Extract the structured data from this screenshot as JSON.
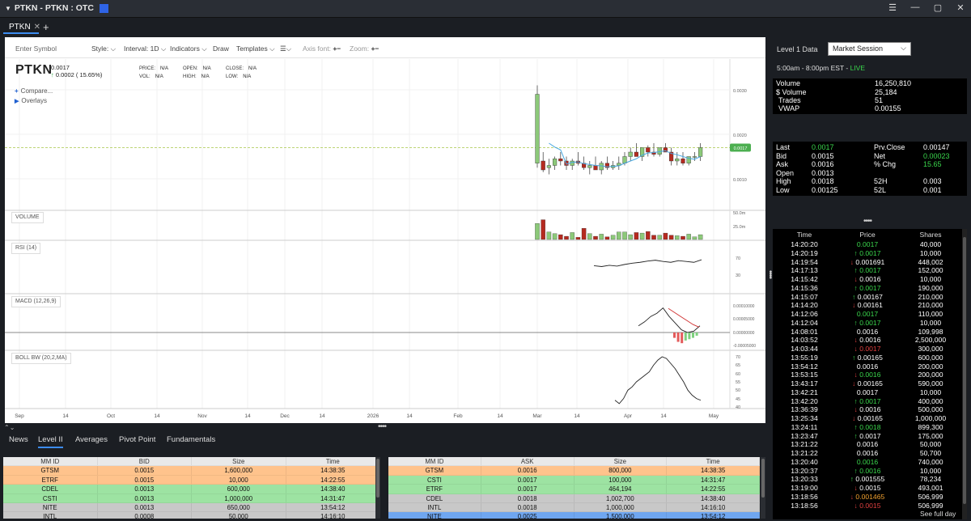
{
  "window": {
    "title": "PTKN - PTKN : OTC"
  },
  "tabs": [
    {
      "label": "PTKN"
    }
  ],
  "toolbar": {
    "enter_symbol": "Enter Symbol",
    "style": "Style:",
    "interval": "Interval: 1D",
    "indicators": "Indicators",
    "draw": "Draw",
    "templates": "Templates",
    "axis_font": "Axis font:",
    "zoom": "Zoom:"
  },
  "quote_header": {
    "symbol": "PTKN",
    "last": "0.0017",
    "change": "0.0002 ( 15.65%)",
    "price_label": "PRICE:",
    "price": "N/A",
    "vol_label": "VOL:",
    "vol": "N/A",
    "open_label": "OPEN:",
    "open": "N/A",
    "high_label": "HIGH:",
    "high": "N/A",
    "close_label": "CLOSE:",
    "close": "N/A",
    "low_label": "LOW:",
    "low": "N/A",
    "compare": "Compare...",
    "overlays": "Overlays"
  },
  "panes": {
    "volume": "VOLUME",
    "rsi": "RSI (14)",
    "macd": "MACD (12,26,9)",
    "boll": "BOLL BW (20,2,MA)"
  },
  "price_axis": [
    "0.0030",
    "0.0020",
    "0.0010"
  ],
  "price_marker": "0.0017",
  "volume_axis": [
    "50.0m",
    "25.0m"
  ],
  "rsi_axis": [
    "70",
    "30"
  ],
  "macd_axis": [
    "0.00010000",
    "0.00005000",
    "0.00000000",
    "-0.00005000"
  ],
  "boll_axis": [
    "70",
    "65",
    "60",
    "55",
    "50",
    "45",
    "40"
  ],
  "x_axis": [
    "Sep",
    "14",
    "Oct",
    "14",
    "Nov",
    "14",
    "Dec",
    "14",
    "2026",
    "14",
    "Feb",
    "14",
    "Mar",
    "14",
    "Apr",
    "14",
    "May"
  ],
  "chart_data": {
    "type": "candlestick",
    "candles": [
      {
        "open": 0.00135,
        "high": 0.0031,
        "low": 0.00125,
        "close": 0.0029
      },
      {
        "open": 0.0014,
        "high": 0.0016,
        "low": 0.00115,
        "close": 0.0012
      },
      {
        "open": 0.00125,
        "high": 0.00145,
        "low": 0.0011,
        "close": 0.0013
      },
      {
        "open": 0.0013,
        "high": 0.0015,
        "low": 0.0012,
        "close": 0.00145
      },
      {
        "open": 0.00145,
        "high": 0.0016,
        "low": 0.0013,
        "close": 0.0014
      },
      {
        "open": 0.0014,
        "high": 0.0015,
        "low": 0.0012,
        "close": 0.0013
      },
      {
        "open": 0.0013,
        "high": 0.00145,
        "low": 0.0012,
        "close": 0.0014
      },
      {
        "open": 0.0014,
        "high": 0.0016,
        "low": 0.0013,
        "close": 0.00135
      },
      {
        "open": 0.00135,
        "high": 0.0015,
        "low": 0.0012,
        "close": 0.00125
      },
      {
        "open": 0.00125,
        "high": 0.0014,
        "low": 0.0011,
        "close": 0.0013
      },
      {
        "open": 0.0013,
        "high": 0.0015,
        "low": 0.0012,
        "close": 0.0012
      },
      {
        "open": 0.0012,
        "high": 0.0014,
        "low": 0.0011,
        "close": 0.00135
      },
      {
        "open": 0.00135,
        "high": 0.0015,
        "low": 0.0012,
        "close": 0.00125
      },
      {
        "open": 0.00125,
        "high": 0.0014,
        "low": 0.0012,
        "close": 0.0013
      },
      {
        "open": 0.0013,
        "high": 0.0015,
        "low": 0.0012,
        "close": 0.00135
      },
      {
        "open": 0.00135,
        "high": 0.0016,
        "low": 0.0013,
        "close": 0.0015
      },
      {
        "open": 0.0015,
        "high": 0.0017,
        "low": 0.0014,
        "close": 0.0016
      },
      {
        "open": 0.0016,
        "high": 0.0018,
        "low": 0.0015,
        "close": 0.0015
      },
      {
        "open": 0.0015,
        "high": 0.0017,
        "low": 0.0014,
        "close": 0.0017
      },
      {
        "open": 0.0017,
        "high": 0.00175,
        "low": 0.0015,
        "close": 0.0016
      },
      {
        "open": 0.0016,
        "high": 0.0018,
        "low": 0.0015,
        "close": 0.00155
      },
      {
        "open": 0.00155,
        "high": 0.0017,
        "low": 0.0015,
        "close": 0.0017
      },
      {
        "open": 0.0017,
        "high": 0.0018,
        "low": 0.0016,
        "close": 0.0016
      },
      {
        "open": 0.0016,
        "high": 0.0017,
        "low": 0.0013,
        "close": 0.0014
      },
      {
        "open": 0.0014,
        "high": 0.0016,
        "low": 0.0013,
        "close": 0.00145
      },
      {
        "open": 0.00145,
        "high": 0.0016,
        "low": 0.0013,
        "close": 0.00135
      },
      {
        "open": 0.00135,
        "high": 0.0015,
        "low": 0.0013,
        "close": 0.0015
      },
      {
        "open": 0.0015,
        "high": 0.0016,
        "low": 0.0014,
        "close": 0.0015
      },
      {
        "open": 0.0015,
        "high": 0.0018,
        "low": 0.0014,
        "close": 0.0017
      }
    ],
    "volume": [
      30,
      37,
      14,
      11,
      9,
      6,
      13,
      4,
      21,
      11,
      6,
      10,
      5,
      8,
      14,
      14,
      9,
      13,
      12,
      15,
      8,
      8,
      12,
      8,
      7,
      6,
      10,
      5,
      9
    ],
    "rsi": [
      52,
      50,
      53,
      51,
      55,
      58,
      60,
      63,
      65,
      62,
      60,
      64,
      62,
      60,
      66
    ],
    "macd": [
      2.5e-05,
      4e-05,
      6e-05,
      7.2e-05,
      9.2e-05,
      6e-05,
      3.5e-05,
      1e-05,
      0.0,
      5e-06,
      2.5e-05
    ],
    "macd_signal": [
      9e-05,
      7.5e-05,
      6e-05,
      4.5e-05,
      3e-05,
      2e-05
    ],
    "macd_hist": [
      -2e-05,
      -3.5e-05,
      -4e-05,
      -3e-05,
      -2.5e-05,
      -2e-05,
      -1.2e-05
    ],
    "boll_bw": [
      44,
      42,
      45,
      50,
      52,
      55,
      57,
      59,
      61,
      65,
      68,
      70,
      69,
      66,
      63,
      59,
      55,
      50,
      47,
      45,
      44
    ]
  },
  "bottom_tabs": [
    "News",
    "Level II",
    "Averages",
    "Pivot Point",
    "Fundamentals"
  ],
  "level2": {
    "bid_headers": [
      "MM ID",
      "BID",
      "Size",
      "Time"
    ],
    "bids": [
      {
        "mm": "GTSM",
        "price": "0.0015",
        "size": "1,600,000",
        "time": "14:38:35"
      },
      {
        "mm": "ETRF",
        "price": "0.0015",
        "size": "10,000",
        "time": "14:22:55"
      },
      {
        "mm": "CDEL",
        "price": "0.0013",
        "size": "600,000",
        "time": "14:38:40"
      },
      {
        "mm": "CSTI",
        "price": "0.0013",
        "size": "1,000,000",
        "time": "14:31:47"
      },
      {
        "mm": "NITE",
        "price": "0.0013",
        "size": "650,000",
        "time": "13:54:12"
      },
      {
        "mm": "INTL",
        "price": "0.0008",
        "size": "50,000",
        "time": "14:16:10"
      }
    ],
    "ask_headers": [
      "MM ID",
      "ASK",
      "Size",
      "Time"
    ],
    "asks": [
      {
        "mm": "GTSM",
        "price": "0.0016",
        "size": "800,000",
        "time": "14:38:35"
      },
      {
        "mm": "CSTI",
        "price": "0.0017",
        "size": "100,000",
        "time": "14:31:47"
      },
      {
        "mm": "ETRF",
        "price": "0.0017",
        "size": "464,194",
        "time": "14:22:55"
      },
      {
        "mm": "CDEL",
        "price": "0.0018",
        "size": "1,002,700",
        "time": "14:38:40"
      },
      {
        "mm": "INTL",
        "price": "0.0018",
        "size": "1,000,000",
        "time": "14:16:10"
      },
      {
        "mm": "NITE",
        "price": "0.0025",
        "size": "1,500,000",
        "time": "13:54:12"
      }
    ],
    "row_colors": [
      "#ffc38c",
      "#ffc38c",
      "#9de3a2",
      "#9de3a2",
      "#c8c8c8",
      "#c8c8c8"
    ],
    "ask_row_colors": [
      "#ffc38c",
      "#9de3a2",
      "#9de3a2",
      "#c8c8c8",
      "#c8c8c8",
      "#6fa6f0"
    ]
  },
  "level1": {
    "label": "Level 1 Data",
    "session": "Market Session",
    "hours": "5:00am - 8:00pm EST -",
    "live": "LIVE",
    "volume_label": "Volume",
    "volume": "16,250,810",
    "dollar_volume_label": "$ Volume",
    "dollar_volume": "25,184",
    "trades_label": "Trades",
    "trades": "51",
    "vwap_label": "VWAP",
    "vwap": "0.00155",
    "last_label": "Last",
    "last": "0.0017",
    "prv_close_label": "Prv.Close",
    "prv_close": "0.00147",
    "bid_label": "Bid",
    "bid": "0.0015",
    "net_label": "Net",
    "net": "0.00023",
    "ask_label": "Ask",
    "ask": "0.0016",
    "pchg_label": "% Chg",
    "pchg": "15.65",
    "open_label": "Open",
    "open": "0.0013",
    "high_label": "High",
    "high": "0.0018",
    "h52_label": "52H",
    "h52": "0.003",
    "low_label": "Low",
    "low": "0.00125",
    "l52_label": "52L",
    "l52": "0.001"
  },
  "time_sales": {
    "headers": [
      "Time",
      "Price",
      "Shares"
    ],
    "see_full_day": "See full day",
    "rows": [
      {
        "time": "14:20:20",
        "price": "0.0017",
        "dir": "none",
        "color": "green",
        "shares": "40,000"
      },
      {
        "time": "14:20:19",
        "price": "0.0017",
        "dir": "up",
        "color": "green",
        "shares": "10,000"
      },
      {
        "time": "14:19:54",
        "price": "0.001691",
        "dir": "down",
        "color": "white",
        "shares": "448,002"
      },
      {
        "time": "14:17:13",
        "price": "0.0017",
        "dir": "up",
        "color": "green",
        "shares": "152,000"
      },
      {
        "time": "14:15:42",
        "price": "0.0016",
        "dir": "down",
        "color": "white",
        "shares": "10,000"
      },
      {
        "time": "14:15:36",
        "price": "0.0017",
        "dir": "up",
        "color": "green",
        "shares": "190,000"
      },
      {
        "time": "14:15:07",
        "price": "0.00167",
        "dir": "up",
        "color": "white",
        "shares": "210,000"
      },
      {
        "time": "14:14:20",
        "price": "0.00161",
        "dir": "down",
        "color": "white",
        "shares": "210,000"
      },
      {
        "time": "14:12:06",
        "price": "0.0017",
        "dir": "none",
        "color": "green",
        "shares": "110,000"
      },
      {
        "time": "14:12:04",
        "price": "0.0017",
        "dir": "up",
        "color": "green",
        "shares": "10,000"
      },
      {
        "time": "14:08:01",
        "price": "0.0016",
        "dir": "none",
        "color": "white",
        "shares": "109,998"
      },
      {
        "time": "14:03:52",
        "price": "0.0016",
        "dir": "down",
        "color": "white",
        "shares": "2,500,000"
      },
      {
        "time": "14:03:44",
        "price": "0.0017",
        "dir": "down",
        "color": "red",
        "shares": "300,000"
      },
      {
        "time": "13:55:19",
        "price": "0.00165",
        "dir": "up",
        "color": "white",
        "shares": "600,000"
      },
      {
        "time": "13:54:12",
        "price": "0.0016",
        "dir": "none",
        "color": "white",
        "shares": "200,000"
      },
      {
        "time": "13:53:15",
        "price": "0.0016",
        "dir": "down",
        "color": "green",
        "shares": "200,000"
      },
      {
        "time": "13:43:17",
        "price": "0.00165",
        "dir": "down",
        "color": "white",
        "shares": "590,000"
      },
      {
        "time": "13:42:21",
        "price": "0.0017",
        "dir": "none",
        "color": "white",
        "shares": "10,000"
      },
      {
        "time": "13:42:20",
        "price": "0.0017",
        "dir": "up",
        "color": "green",
        "shares": "400,000"
      },
      {
        "time": "13:36:39",
        "price": "0.0016",
        "dir": "down",
        "color": "white",
        "shares": "500,000"
      },
      {
        "time": "13:25:34",
        "price": "0.00165",
        "dir": "down",
        "color": "white",
        "shares": "1,000,000"
      },
      {
        "time": "13:24:11",
        "price": "0.0018",
        "dir": "up",
        "color": "green",
        "shares": "899,300"
      },
      {
        "time": "13:23:47",
        "price": "0.0017",
        "dir": "up",
        "color": "white",
        "shares": "175,000"
      },
      {
        "time": "13:21:22",
        "price": "0.0016",
        "dir": "none",
        "color": "white",
        "shares": "50,000"
      },
      {
        "time": "13:21:22",
        "price": "0.0016",
        "dir": "none",
        "color": "white",
        "shares": "50,700"
      },
      {
        "time": "13:20:40",
        "price": "0.0016",
        "dir": "none",
        "color": "green",
        "shares": "740,000"
      },
      {
        "time": "13:20:37",
        "price": "0.0016",
        "dir": "up",
        "color": "green",
        "shares": "10,000"
      },
      {
        "time": "13:20:33",
        "price": "0.001555",
        "dir": "up",
        "color": "white",
        "shares": "78,234"
      },
      {
        "time": "13:19:00",
        "price": "0.0015",
        "dir": "down",
        "color": "white",
        "shares": "493,001"
      },
      {
        "time": "13:18:56",
        "price": "0.001465",
        "dir": "down",
        "color": "orange",
        "shares": "506,999"
      },
      {
        "time": "13:18:56",
        "price": "0.0015",
        "dir": "down",
        "color": "red",
        "shares": "506,999"
      }
    ]
  },
  "colors": {
    "accent": "#3c8cf0",
    "up": "#3ad64c",
    "down": "#e04040",
    "candle_up": "#8cc979",
    "candle_down": "#b52a20"
  }
}
